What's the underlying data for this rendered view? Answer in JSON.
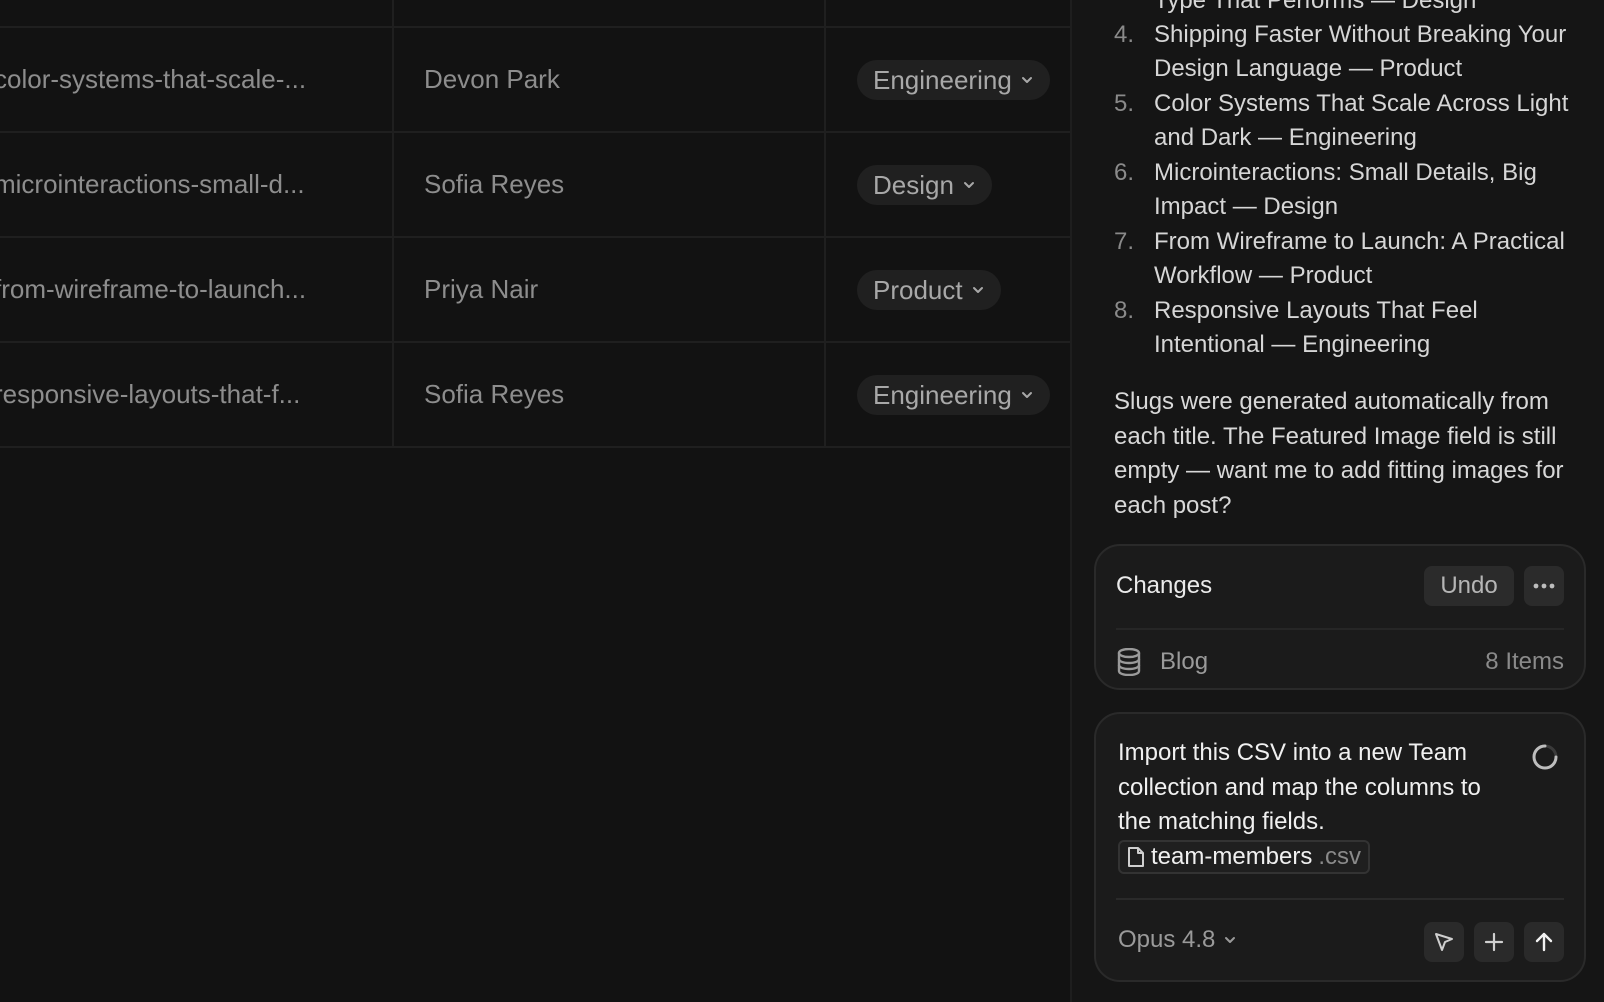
{
  "table": {
    "rows": [
      {
        "slug": "color-systems-that-scale-...",
        "author": "Devon Park",
        "category": "Engineering"
      },
      {
        "slug": "microinteractions-small-d...",
        "author": "Sofia Reyes",
        "category": "Design"
      },
      {
        "slug": "from-wireframe-to-launch...",
        "author": "Priya Nair",
        "category": "Product"
      },
      {
        "slug": "responsive-layouts-that-f...",
        "author": "Sofia Reyes",
        "category": "Engineering"
      }
    ]
  },
  "chat": {
    "list": [
      {
        "num": "",
        "text": "Type That Performs — Design"
      },
      {
        "num": "4.",
        "text": "Shipping Faster Without Breaking Your Design Language — Product"
      },
      {
        "num": "5.",
        "text": "Color Systems That Scale Across Light and Dark — Engineering"
      },
      {
        "num": "6.",
        "text": "Microinteractions: Small Details, Big Impact — Design"
      },
      {
        "num": "7.",
        "text": "From Wireframe to Launch: A Practical Workflow — Product"
      },
      {
        "num": "8.",
        "text": "Responsive Layouts That Feel Intentional — Engineering"
      }
    ],
    "note": "Slugs were generated automatically from each title. The Featured Image field is still empty — want me to add fitting images for each post?"
  },
  "changes": {
    "title": "Changes",
    "undo_label": "Undo",
    "collection": "Blog",
    "count": "8 Items"
  },
  "composer": {
    "prompt": "Import this CSV into a new Team collection and map the columns to the matching fields.",
    "file_name": "team-members",
    "file_ext": ".csv",
    "model": "Opus 4.8"
  }
}
